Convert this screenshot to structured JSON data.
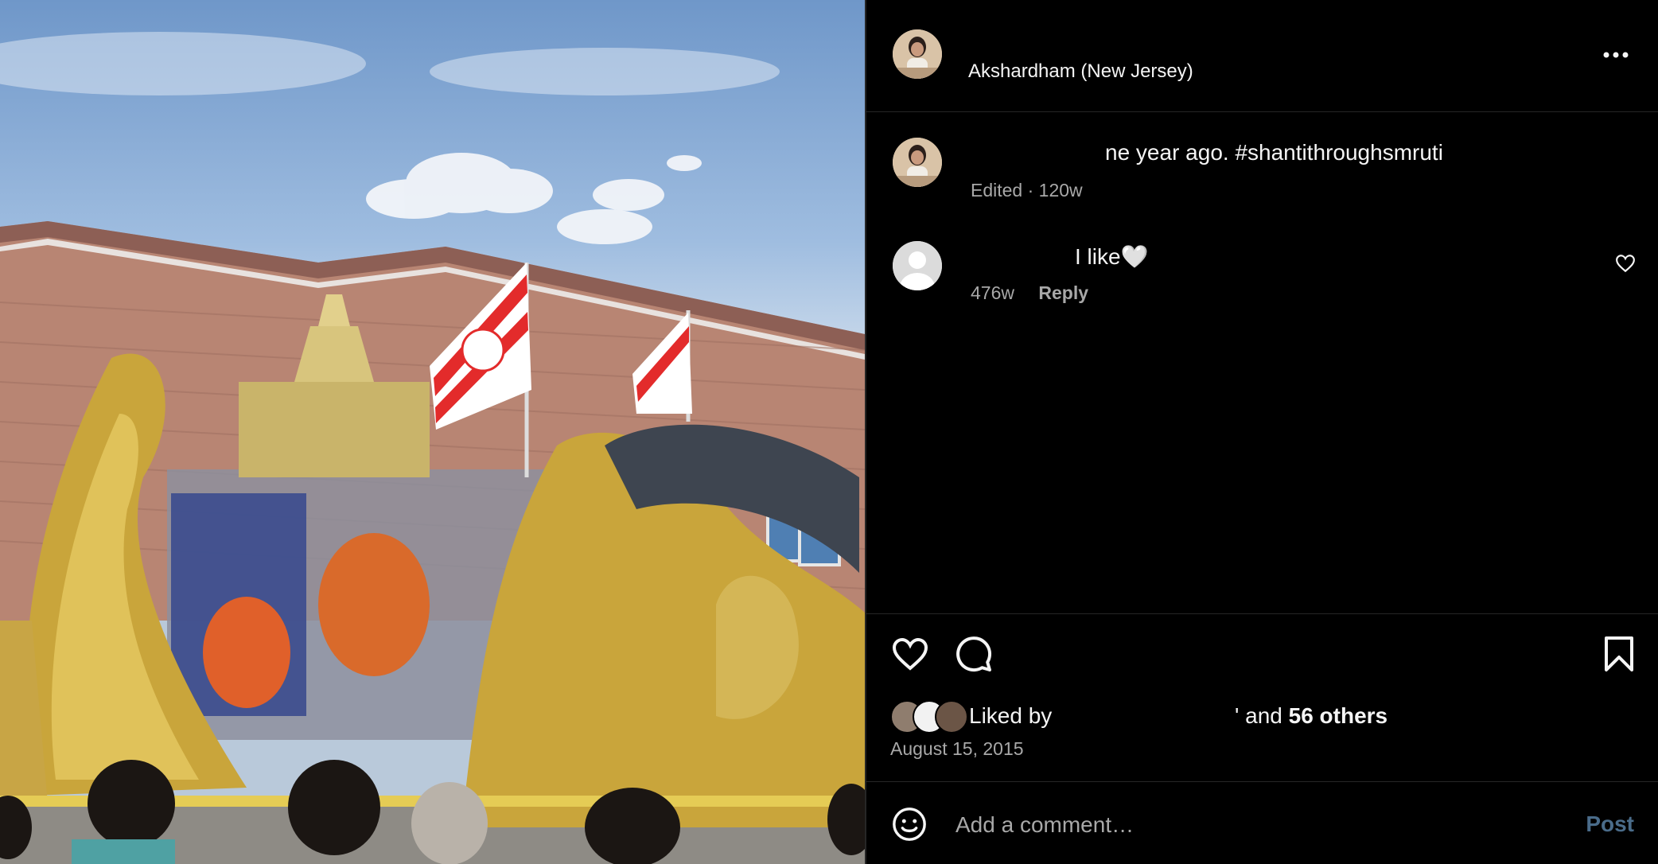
{
  "post": {
    "location": "Akshardham (New Jersey)",
    "caption": "ne year ago. #shantithroughsmruti",
    "caption_meta": "Edited · 120w",
    "icons": {
      "more": "more-options-icon",
      "like": "heart-icon",
      "comment": "comment-bubble-icon",
      "save": "bookmark-icon",
      "emoji": "emoji-icon"
    }
  },
  "comment": {
    "text": "I like🤍",
    "time": "476w",
    "reply_label": "Reply"
  },
  "likes": {
    "prefix": "Liked by",
    "suffix_connector": "' and ",
    "others": "56 others"
  },
  "date": "August 15, 2015",
  "composer": {
    "placeholder": "Add a comment…",
    "post_label": "Post"
  },
  "colors": {
    "background": "#000000",
    "text": "#f5f5f5",
    "muted": "#a8a8a8",
    "post_disabled": "#4a6c8a",
    "divider": "#262626"
  }
}
